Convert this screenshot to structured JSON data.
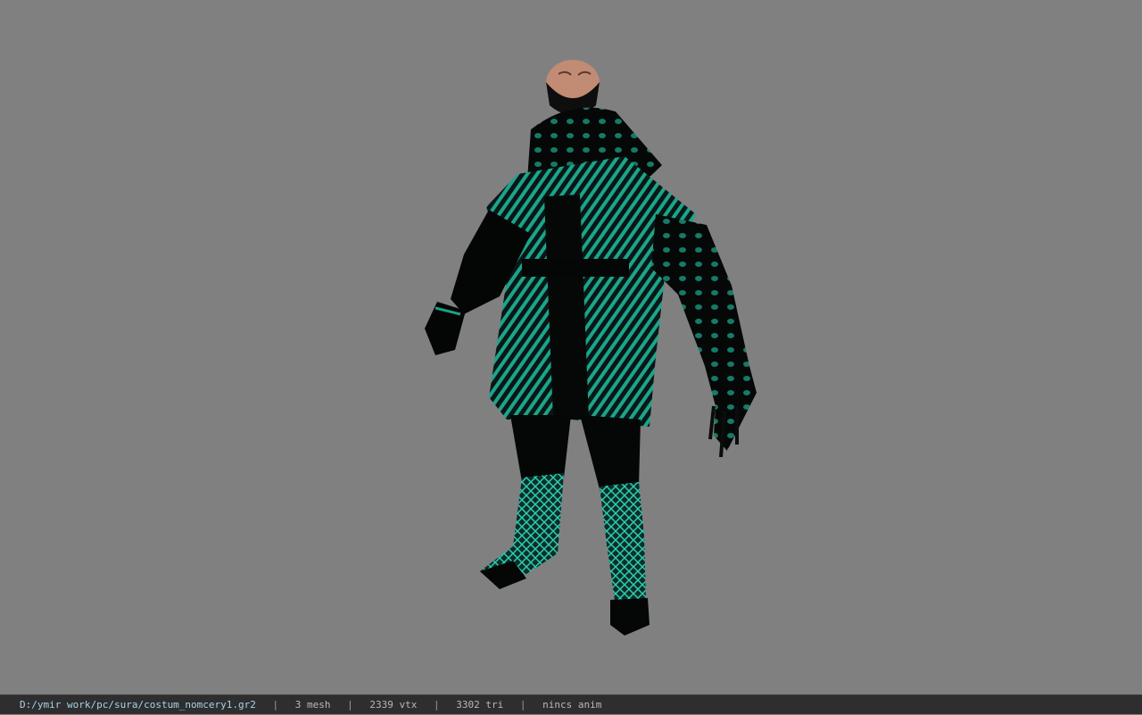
{
  "viewer": {
    "background": "#808080",
    "model_icon": "character-model-icon",
    "accent": "#19b89a"
  },
  "statusbar": {
    "path": "D:/ymir work/pc/sura/costum_nomcery1.gr2",
    "separator": "|",
    "mesh": "3 mesh",
    "vtx": "2339 vtx",
    "tri": "3302 tri",
    "anim": "nincs anim"
  }
}
